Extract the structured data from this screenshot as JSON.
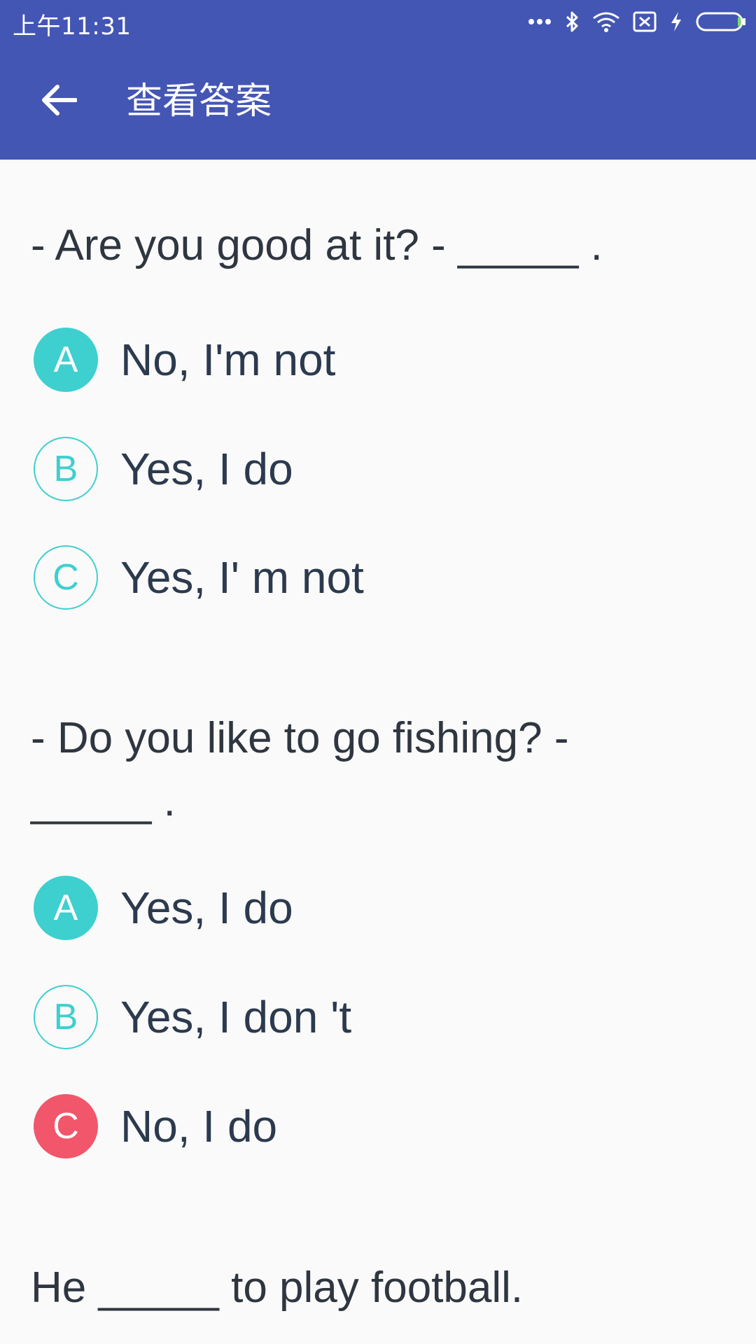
{
  "status_bar": {
    "time": "上午11:31",
    "icons": [
      "more-dots-icon",
      "bluetooth-icon",
      "wifi-icon",
      "sim-off-icon",
      "charging-icon",
      "battery-icon"
    ]
  },
  "app_bar": {
    "back_icon": "arrow-left-icon",
    "title": "查看答案",
    "color": "#4456b4"
  },
  "colors": {
    "correct": "#3ecfcf",
    "wrong": "#f2566a"
  },
  "questions": [
    {
      "text": "- Are you good at it? - _____ .",
      "options": [
        {
          "letter": "A",
          "text": "No, I'm not",
          "state": "correct"
        },
        {
          "letter": "B",
          "text": "Yes, I do",
          "state": "normal"
        },
        {
          "letter": "C",
          "text": "Yes, I' m not",
          "state": "normal"
        }
      ]
    },
    {
      "text": "- Do you like to go fishing? - _____ .",
      "options": [
        {
          "letter": "A",
          "text": "Yes, I do",
          "state": "correct"
        },
        {
          "letter": "B",
          "text": "Yes, I don 't",
          "state": "normal"
        },
        {
          "letter": "C",
          "text": "No, I do",
          "state": "wrong"
        }
      ]
    },
    {
      "text": "He _____ to play football."
    }
  ]
}
